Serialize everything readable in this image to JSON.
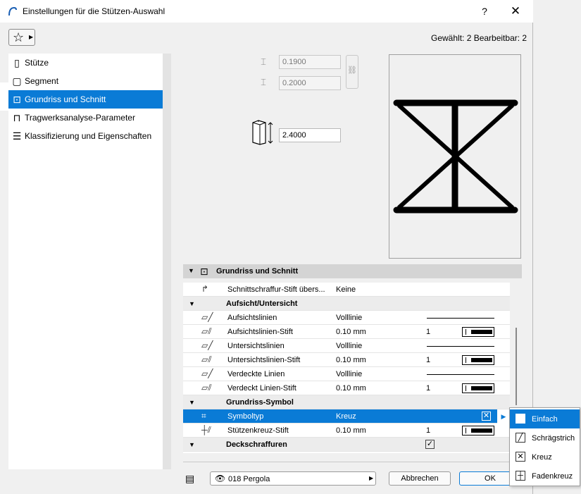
{
  "window": {
    "title": "Einstellungen für die Stützen-Auswahl",
    "help": "?",
    "close": "✕"
  },
  "header": {
    "selected_info": "Gewählt: 2 Bearbeitbar: 2"
  },
  "nav": {
    "items": [
      {
        "label": "Stütze",
        "icon": "column-icon"
      },
      {
        "label": "Segment",
        "icon": "segment-icon"
      },
      {
        "label": "Grundriss und Schnitt",
        "icon": "floorplan-icon"
      },
      {
        "label": "Tragwerksanalyse-Parameter",
        "icon": "structural-icon"
      },
      {
        "label": "Klassifizierung und Eigenschaften",
        "icon": "classification-icon"
      }
    ],
    "active_index": 2
  },
  "dimensions": {
    "width": "0.1900",
    "depth": "0.2000",
    "height": "2.4000"
  },
  "section": {
    "title": "Grundriss und Schnitt"
  },
  "table": {
    "rows": [
      {
        "type": "prop",
        "name": "Schnittschraffur-Stift übers...",
        "value": "Keine"
      },
      {
        "type": "group",
        "name": "Aufsicht/Untersicht"
      },
      {
        "type": "prop",
        "name": "Aufsichtslinien",
        "value": "Volllinie",
        "extra": "line"
      },
      {
        "type": "prop",
        "name": "Aufsichtslinien-Stift",
        "value": "0.10 mm",
        "num": "1",
        "extra": "pen"
      },
      {
        "type": "prop",
        "name": "Untersichtslinien",
        "value": "Volllinie",
        "extra": "line"
      },
      {
        "type": "prop",
        "name": "Untersichtslinien-Stift",
        "value": "0.10 mm",
        "num": "1",
        "extra": "pen"
      },
      {
        "type": "prop",
        "name": "Verdeckte Linien",
        "value": "Volllinie",
        "extra": "line"
      },
      {
        "type": "prop",
        "name": "Verdeckt Linien-Stift",
        "value": "0.10 mm",
        "num": "1",
        "extra": "pen"
      },
      {
        "type": "group",
        "name": "Grundriss-Symbol"
      },
      {
        "type": "prop",
        "name": "Symboltyp",
        "value": "Kreuz",
        "extra": "symbol",
        "selected": true
      },
      {
        "type": "prop",
        "name": "Stützenkreuz-Stift",
        "value": "0.10 mm",
        "num": "1",
        "extra": "pen"
      },
      {
        "type": "group",
        "name": "Deckschraffuren",
        "extra": "check"
      }
    ]
  },
  "popup": {
    "options": [
      "Einfach",
      "Schrägstrich",
      "Kreuz",
      "Fadenkreuz"
    ],
    "highlighted_index": 0,
    "current_index": 2
  },
  "footer": {
    "layer": "018 Pergola",
    "cancel": "Abbrechen",
    "ok": "OK"
  }
}
